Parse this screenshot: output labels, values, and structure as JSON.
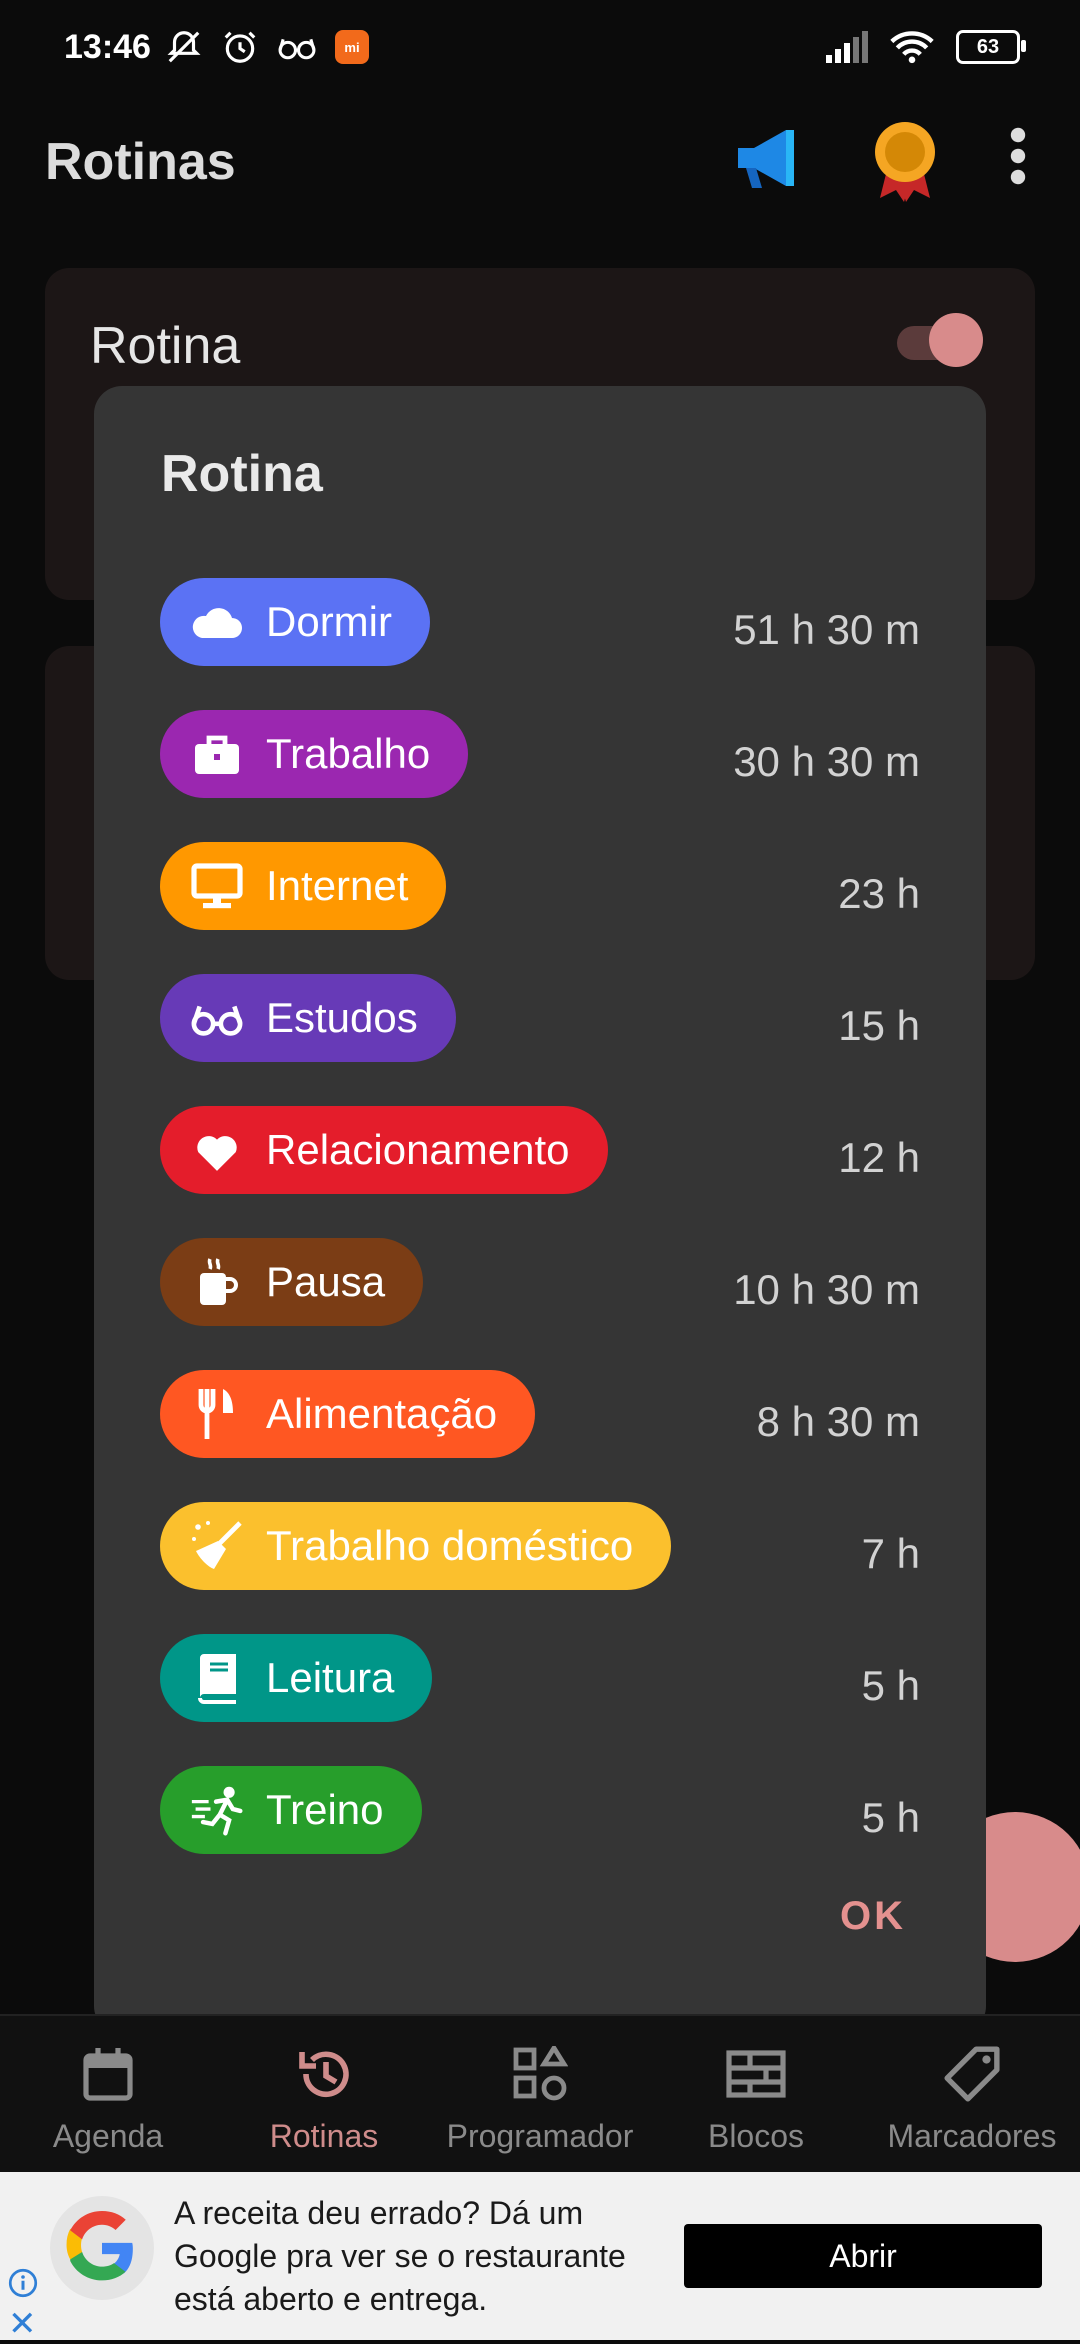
{
  "status": {
    "time": "13:46",
    "battery": "63"
  },
  "app": {
    "title": "Rotinas"
  },
  "background_card": {
    "title": "Rotina"
  },
  "dialog": {
    "title": "Rotina",
    "rows": [
      {
        "label": "Dormir",
        "duration": "51 h 30 m",
        "color": "#5b72f4",
        "icon": "cloud-icon"
      },
      {
        "label": "Trabalho",
        "duration": "30 h 30 m",
        "color": "#9b27b0",
        "icon": "briefcase-icon"
      },
      {
        "label": "Internet",
        "duration": "23 h",
        "color": "#ff9800",
        "icon": "monitor-icon"
      },
      {
        "label": "Estudos",
        "duration": "15 h",
        "color": "#673ab7",
        "icon": "glasses-icon"
      },
      {
        "label": "Relacionamento",
        "duration": "12 h",
        "color": "#e41d2b",
        "icon": "heart-icon"
      },
      {
        "label": "Pausa",
        "duration": "10 h 30 m",
        "color": "#7b3d15",
        "icon": "coffee-icon"
      },
      {
        "label": "Alimentação",
        "duration": "8 h 30 m",
        "color": "#ff5722",
        "icon": "cutlery-icon"
      },
      {
        "label": "Trabalho doméstico",
        "duration": "7 h",
        "color": "#fbc02d",
        "icon": "broom-icon"
      },
      {
        "label": "Leitura",
        "duration": "5 h",
        "color": "#009688",
        "icon": "book-icon"
      },
      {
        "label": "Treino",
        "duration": "5 h",
        "color": "#279e2b",
        "icon": "runner-icon"
      }
    ],
    "ok_label": "OK"
  },
  "nav": [
    {
      "label": "Agenda",
      "icon": "calendar-icon",
      "active": false
    },
    {
      "label": "Rotinas",
      "icon": "history-icon",
      "active": true
    },
    {
      "label": "Programador",
      "icon": "shapes-icon",
      "active": false
    },
    {
      "label": "Blocos",
      "icon": "blocks-icon",
      "active": false
    },
    {
      "label": "Marcadores",
      "icon": "tag-icon",
      "active": false
    }
  ],
  "ad": {
    "text": "A receita deu errado? Dá um Google pra ver se o restaurante está aberto e entrega.",
    "button": "Abrir"
  },
  "colors": {
    "accent": "#d88b8b",
    "dialog_bg": "#353535"
  }
}
